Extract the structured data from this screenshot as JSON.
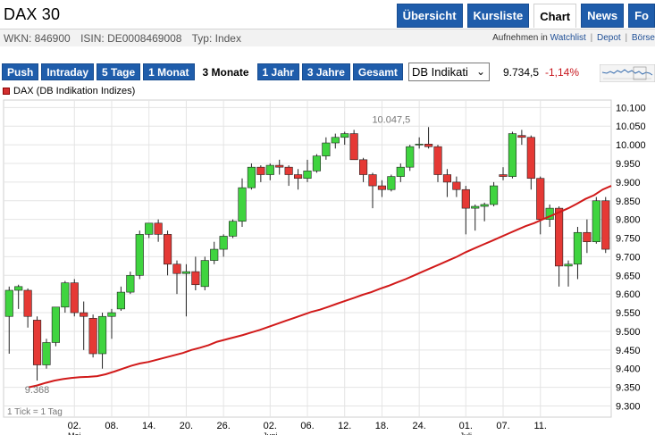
{
  "header": {
    "title": "DAX 30",
    "tabs": [
      {
        "label": "Übersicht",
        "active": false
      },
      {
        "label": "Kursliste",
        "active": false
      },
      {
        "label": "Chart",
        "active": true
      },
      {
        "label": "News",
        "active": false
      },
      {
        "label": "Fo",
        "active": false
      }
    ]
  },
  "meta": {
    "wkn": "WKN: 846900",
    "isin": "ISIN: DE0008469008",
    "typ": "Typ: Index",
    "links": [
      "Aufnehmen in",
      "Watchlist",
      "|",
      "Depot",
      "|",
      "Börse"
    ]
  },
  "toolbar": {
    "ranges": [
      {
        "label": "Push",
        "active": false
      },
      {
        "label": "Intraday",
        "active": false
      },
      {
        "label": "5 Tage",
        "active": false
      },
      {
        "label": "1 Monat",
        "active": false
      },
      {
        "label": "3 Monate",
        "active": true
      },
      {
        "label": "1 Jahr",
        "active": false
      },
      {
        "label": "3 Jahre",
        "active": false
      },
      {
        "label": "Gesamt",
        "active": false
      }
    ],
    "exchange_select": "DB Indikati",
    "price": "9.734,5",
    "change": "-1,14%"
  },
  "colors": {
    "up": "#3fd43f",
    "down": "#e53935",
    "ma": "#d11a1a",
    "nav_blue": "#1f5dab"
  },
  "chart_data": {
    "type": "candlestick",
    "legend": "DAX (DB Indikation Indizes)",
    "y_ticks": [
      "10.100",
      "10.050",
      "10.000",
      "9.950",
      "9.900",
      "9.850",
      "9.800",
      "9.750",
      "9.700",
      "9.650",
      "9.600",
      "9.550",
      "9.500",
      "9.450",
      "9.400",
      "9.350",
      "9.300"
    ],
    "y_tick_values": [
      10100,
      10050,
      10000,
      9950,
      9900,
      9850,
      9800,
      9750,
      9700,
      9650,
      9600,
      9550,
      9500,
      9450,
      9400,
      9350,
      9300
    ],
    "ylim": [
      9270,
      10120
    ],
    "x_ticks": [
      {
        "label": "02.",
        "sub": "Mai",
        "index": 7
      },
      {
        "label": "08.",
        "sub": "",
        "index": 11
      },
      {
        "label": "14.",
        "sub": "",
        "index": 15
      },
      {
        "label": "20.",
        "sub": "",
        "index": 19
      },
      {
        "label": "26.",
        "sub": "",
        "index": 23
      },
      {
        "label": "02.",
        "sub": "Juni",
        "index": 28
      },
      {
        "label": "06.",
        "sub": "",
        "index": 32
      },
      {
        "label": "12.",
        "sub": "",
        "index": 36
      },
      {
        "label": "18.",
        "sub": "",
        "index": 40
      },
      {
        "label": "24.",
        "sub": "",
        "index": 44
      },
      {
        "label": "01.",
        "sub": "Juli",
        "index": 49
      },
      {
        "label": "07.",
        "sub": "",
        "index": 53
      },
      {
        "label": "11.",
        "sub": "",
        "index": 57
      }
    ],
    "annotations": [
      {
        "text": "10.047,5",
        "index": 41,
        "value": 10047.5,
        "pos": "above"
      },
      {
        "text": "9.368",
        "index": 3,
        "value": 9368,
        "pos": "below"
      }
    ],
    "footnote": "1 Tick = 1 Tag",
    "candles": [
      {
        "o": 9540,
        "h": 9620,
        "l": 9440,
        "c": 9610
      },
      {
        "o": 9610,
        "h": 9625,
        "l": 9560,
        "c": 9620
      },
      {
        "o": 9610,
        "h": 9615,
        "l": 9510,
        "c": 9540
      },
      {
        "o": 9530,
        "h": 9540,
        "l": 9368,
        "c": 9410
      },
      {
        "o": 9410,
        "h": 9480,
        "l": 9400,
        "c": 9470
      },
      {
        "o": 9470,
        "h": 9565,
        "l": 9460,
        "c": 9565
      },
      {
        "o": 9565,
        "h": 9635,
        "l": 9550,
        "c": 9630
      },
      {
        "o": 9630,
        "h": 9640,
        "l": 9540,
        "c": 9550
      },
      {
        "o": 9550,
        "h": 9580,
        "l": 9450,
        "c": 9540
      },
      {
        "o": 9535,
        "h": 9545,
        "l": 9430,
        "c": 9440
      },
      {
        "o": 9440,
        "h": 9550,
        "l": 9400,
        "c": 9540
      },
      {
        "o": 9540,
        "h": 9560,
        "l": 9480,
        "c": 9550
      },
      {
        "o": 9560,
        "h": 9620,
        "l": 9555,
        "c": 9605
      },
      {
        "o": 9605,
        "h": 9660,
        "l": 9600,
        "c": 9650
      },
      {
        "o": 9650,
        "h": 9770,
        "l": 9640,
        "c": 9760
      },
      {
        "o": 9760,
        "h": 9790,
        "l": 9750,
        "c": 9790
      },
      {
        "o": 9790,
        "h": 9800,
        "l": 9740,
        "c": 9760
      },
      {
        "o": 9760,
        "h": 9770,
        "l": 9650,
        "c": 9680
      },
      {
        "o": 9680,
        "h": 9690,
        "l": 9600,
        "c": 9655
      },
      {
        "o": 9655,
        "h": 9680,
        "l": 9540,
        "c": 9660
      },
      {
        "o": 9660,
        "h": 9700,
        "l": 9610,
        "c": 9625
      },
      {
        "o": 9620,
        "h": 9700,
        "l": 9610,
        "c": 9690
      },
      {
        "o": 9690,
        "h": 9740,
        "l": 9680,
        "c": 9720
      },
      {
        "o": 9720,
        "h": 9760,
        "l": 9700,
        "c": 9755
      },
      {
        "o": 9755,
        "h": 9800,
        "l": 9750,
        "c": 9795
      },
      {
        "o": 9795,
        "h": 9910,
        "l": 9780,
        "c": 9885
      },
      {
        "o": 9885,
        "h": 9950,
        "l": 9880,
        "c": 9940
      },
      {
        "o": 9940,
        "h": 9945,
        "l": 9900,
        "c": 9920
      },
      {
        "o": 9920,
        "h": 9950,
        "l": 9905,
        "c": 9945
      },
      {
        "o": 9945,
        "h": 9960,
        "l": 9920,
        "c": 9940
      },
      {
        "o": 9940,
        "h": 9945,
        "l": 9890,
        "c": 9920
      },
      {
        "o": 9920,
        "h": 9935,
        "l": 9880,
        "c": 9910
      },
      {
        "o": 9910,
        "h": 9960,
        "l": 9900,
        "c": 9930
      },
      {
        "o": 9930,
        "h": 9975,
        "l": 9925,
        "c": 9970
      },
      {
        "o": 9970,
        "h": 10020,
        "l": 9960,
        "c": 10005
      },
      {
        "o": 10005,
        "h": 10030,
        "l": 9990,
        "c": 10020
      },
      {
        "o": 10020,
        "h": 10035,
        "l": 10000,
        "c": 10030
      },
      {
        "o": 10030,
        "h": 10040,
        "l": 9960,
        "c": 9960
      },
      {
        "o": 9960,
        "h": 9965,
        "l": 9900,
        "c": 9920
      },
      {
        "o": 9920,
        "h": 9925,
        "l": 9830,
        "c": 9890
      },
      {
        "o": 9890,
        "h": 9905,
        "l": 9860,
        "c": 9880
      },
      {
        "o": 9880,
        "h": 9920,
        "l": 9875,
        "c": 9915
      },
      {
        "o": 9915,
        "h": 9950,
        "l": 9900,
        "c": 9940
      },
      {
        "o": 9940,
        "h": 10000,
        "l": 9930,
        "c": 9995
      },
      {
        "o": 10000,
        "h": 10020,
        "l": 9990,
        "c": 10002
      },
      {
        "o": 10002,
        "h": 10047.5,
        "l": 9990,
        "c": 9995
      },
      {
        "o": 9995,
        "h": 10000,
        "l": 9900,
        "c": 9920
      },
      {
        "o": 9920,
        "h": 9935,
        "l": 9860,
        "c": 9900
      },
      {
        "o": 9900,
        "h": 9915,
        "l": 9860,
        "c": 9880
      },
      {
        "o": 9880,
        "h": 9890,
        "l": 9760,
        "c": 9830
      },
      {
        "o": 9830,
        "h": 9840,
        "l": 9770,
        "c": 9835
      },
      {
        "o": 9835,
        "h": 9845,
        "l": 9795,
        "c": 9840
      },
      {
        "o": 9840,
        "h": 9900,
        "l": 9835,
        "c": 9890
      },
      {
        "o": 9920,
        "h": 9940,
        "l": 9905,
        "c": 9915
      },
      {
        "o": 9915,
        "h": 10035,
        "l": 9910,
        "c": 10030
      },
      {
        "o": 10025,
        "h": 10040,
        "l": 10000,
        "c": 10020
      },
      {
        "o": 10020,
        "h": 10025,
        "l": 9880,
        "c": 9910
      },
      {
        "o": 9910,
        "h": 9915,
        "l": 9760,
        "c": 9800
      },
      {
        "o": 9800,
        "h": 9840,
        "l": 9780,
        "c": 9830
      },
      {
        "o": 9830,
        "h": 9835,
        "l": 9620,
        "c": 9675
      },
      {
        "o": 9675,
        "h": 9690,
        "l": 9620,
        "c": 9680
      },
      {
        "o": 9680,
        "h": 9780,
        "l": 9640,
        "c": 9765
      },
      {
        "o": 9765,
        "h": 9800,
        "l": 9710,
        "c": 9740
      },
      {
        "o": 9740,
        "h": 9860,
        "l": 9735,
        "c": 9850
      },
      {
        "o": 9850,
        "h": 9860,
        "l": 9710,
        "c": 9720
      }
    ],
    "moving_average": [
      9350,
      9355,
      9362,
      9368,
      9372,
      9375,
      9377,
      9378,
      9380,
      9385,
      9392,
      9400,
      9408,
      9414,
      9418,
      9424,
      9430,
      9436,
      9442,
      9450,
      9456,
      9463,
      9472,
      9478,
      9484,
      9490,
      9497,
      9504,
      9512,
      9520,
      9528,
      9536,
      9544,
      9552,
      9558,
      9566,
      9574,
      9582,
      9590,
      9598,
      9605,
      9614,
      9622,
      9631,
      9640,
      9650,
      9660,
      9670,
      9680,
      9690,
      9700,
      9712,
      9722,
      9732,
      9742,
      9752,
      9762,
      9772,
      9782,
      9790,
      9800,
      9810,
      9820,
      9830,
      9842,
      9855,
      9865,
      9880,
      9890
    ]
  }
}
